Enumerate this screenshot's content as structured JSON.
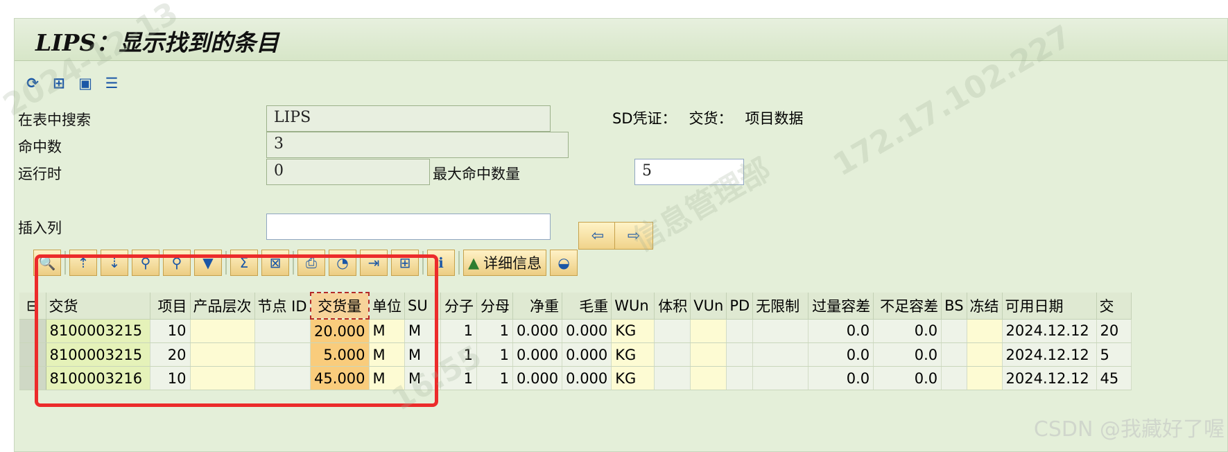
{
  "title": "LIPS：显示找到的条目",
  "toolbar_top_icons": [
    "refresh-icon",
    "tree-icon",
    "layout-icon",
    "list-icon"
  ],
  "form": {
    "search_table_label": "在表中搜索",
    "search_table_value": "LIPS",
    "sd_doc_label": "SD凭证：",
    "sd_doc_type": "交货：",
    "sd_doc_desc": "项目数据",
    "hits_label": "命中数",
    "hits_value": "3",
    "runtime_label": "运行时",
    "runtime_value": "0",
    "max_hits_label": "最大命中数量",
    "max_hits_value": "5",
    "insert_col_label": "插入列",
    "insert_col_value": ""
  },
  "grid_toolbar": {
    "details_label": "详细信息"
  },
  "grid": {
    "columns": [
      "交货",
      "项目",
      "产品层次",
      "节点 ID",
      "交货量",
      "单位",
      "SU",
      "分子",
      "分母",
      "净重",
      "毛重",
      "WUn",
      "体积",
      "VUn",
      "PD",
      "无限制",
      "过量容差",
      "不足容差",
      "BS",
      "冻结",
      "可用日期",
      "交"
    ],
    "rows": [
      [
        "8100003215",
        "10",
        "",
        "",
        "20.000",
        "M",
        "M",
        "1",
        "1",
        "0.000",
        "0.000",
        "KG",
        "",
        "",
        "",
        "",
        "0.0",
        "0.0",
        "",
        "",
        "2024.12.12",
        "20"
      ],
      [
        "8100003215",
        "20",
        "",
        "",
        "5.000",
        "M",
        "M",
        "1",
        "1",
        "0.000",
        "0.000",
        "KG",
        "",
        "",
        "",
        "",
        "0.0",
        "0.0",
        "",
        "",
        "2024.12.12",
        "5"
      ],
      [
        "8100003216",
        "10",
        "",
        "",
        "45.000",
        "M",
        "M",
        "1",
        "1",
        "0.000",
        "0.000",
        "KG",
        "",
        "",
        "",
        "",
        "0.0",
        "0.0",
        "",
        "",
        "2024.12.12",
        "45"
      ]
    ]
  },
  "watermark": {
    "ip": "172.17.102.227",
    "dept": "信息管理部",
    "date": "2024-12-13",
    "time": "16:55"
  },
  "csdn_credit": "CSDN @我藏好了喔",
  "colors": {
    "highlight": "#ec2b2b",
    "key_column": "#e5f2b9",
    "selected_column": "#f9cc7c",
    "background": "#e4efd9"
  }
}
